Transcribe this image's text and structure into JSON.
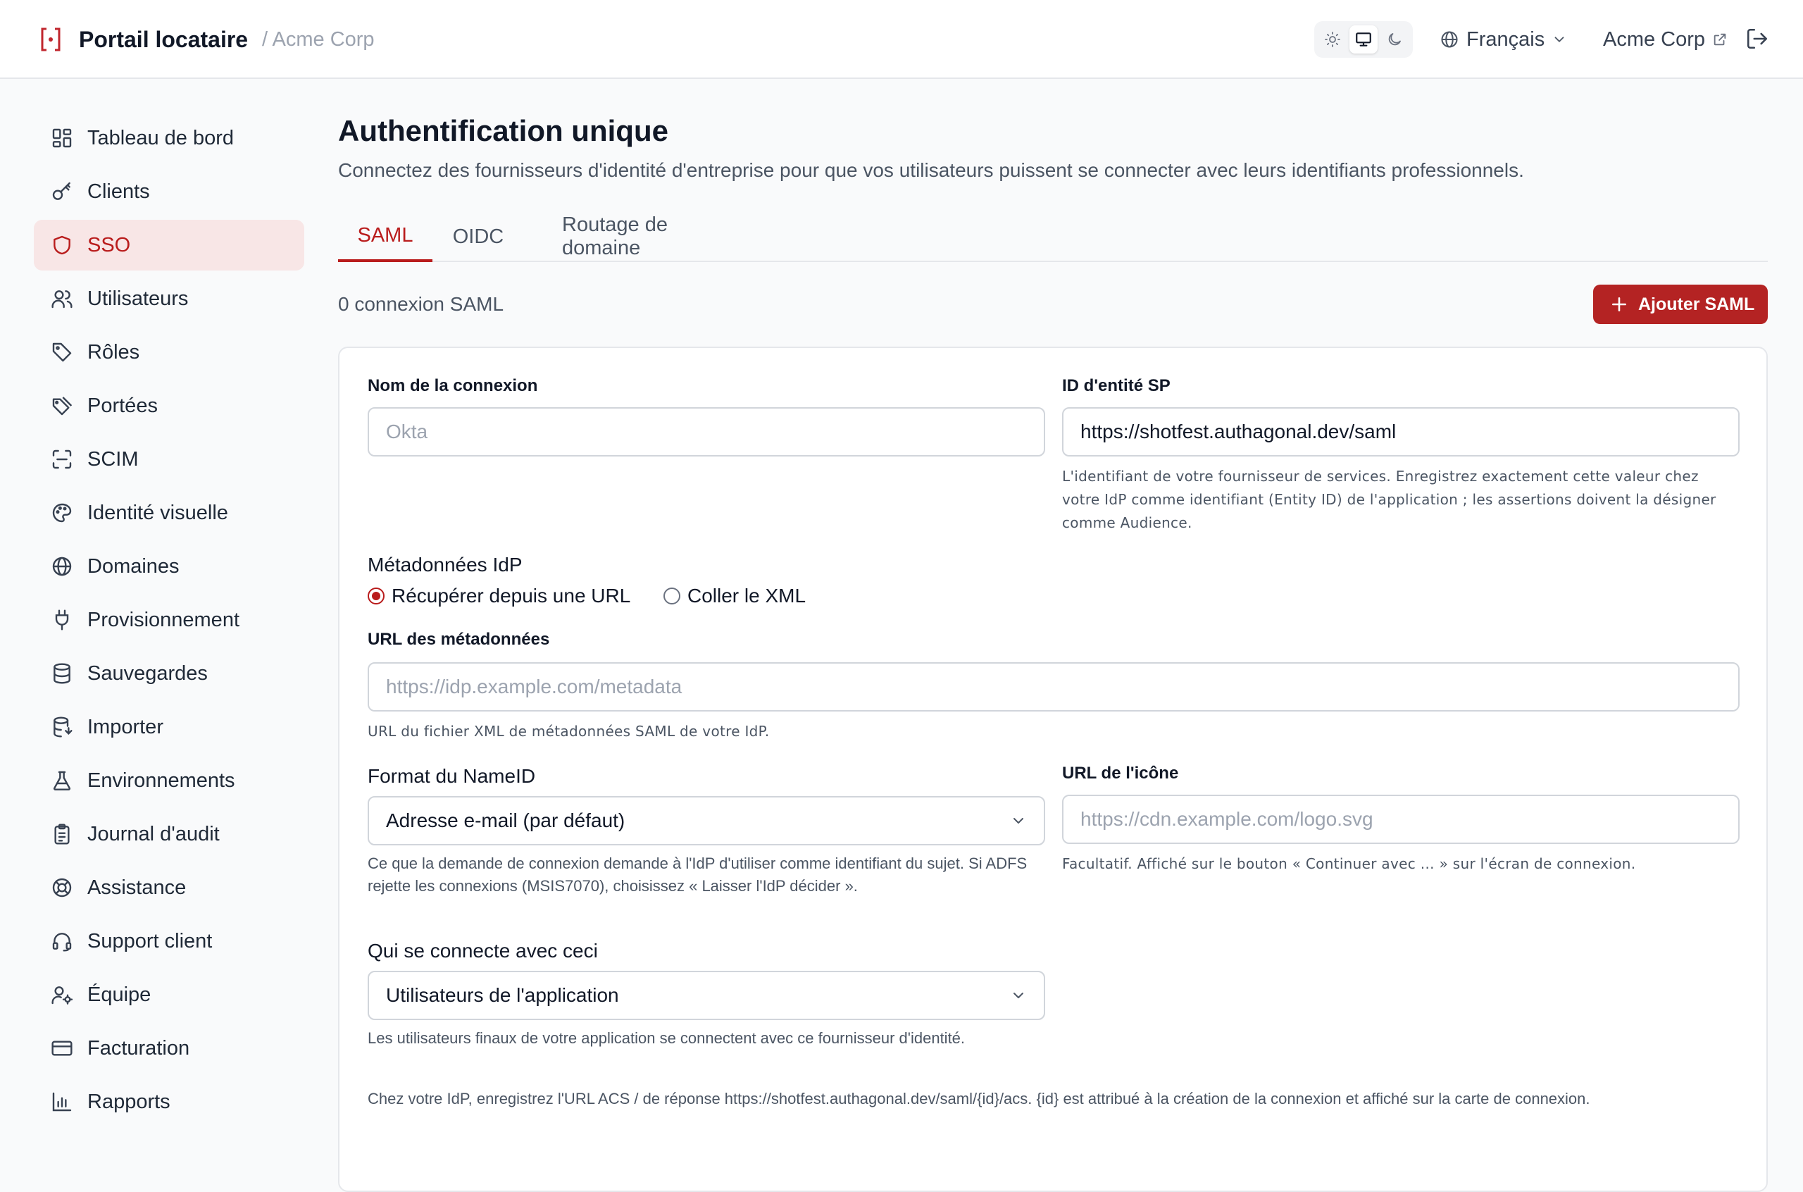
{
  "header": {
    "app_title": "Portail locataire",
    "breadcrumb_sep": "/ Acme Corp",
    "language": "Français",
    "tenant_link": "Acme Corp",
    "theme_options": [
      "light",
      "system",
      "dark"
    ],
    "theme_selected": "system"
  },
  "sidebar": {
    "items": [
      {
        "label": "Tableau de bord",
        "icon": "dashboard-icon"
      },
      {
        "label": "Clients",
        "icon": "key-icon"
      },
      {
        "label": "SSO",
        "icon": "shield-icon",
        "active": true
      },
      {
        "label": "Utilisateurs",
        "icon": "users-icon"
      },
      {
        "label": "Rôles",
        "icon": "tag-icon"
      },
      {
        "label": "Portées",
        "icon": "tags-icon"
      },
      {
        "label": "SCIM",
        "icon": "scan-icon"
      },
      {
        "label": "Identité visuelle",
        "icon": "palette-icon"
      },
      {
        "label": "Domaines",
        "icon": "globe-icon"
      },
      {
        "label": "Provisionnement",
        "icon": "plug-icon"
      },
      {
        "label": "Sauvegardes",
        "icon": "database-icon"
      },
      {
        "label": "Importer",
        "icon": "database-import-icon"
      },
      {
        "label": "Environnements",
        "icon": "flask-icon"
      },
      {
        "label": "Journal d'audit",
        "icon": "clipboard-icon"
      },
      {
        "label": "Assistance",
        "icon": "lifebuoy-icon"
      },
      {
        "label": "Support client",
        "icon": "headset-icon"
      },
      {
        "label": "Équipe",
        "icon": "user-cog-icon"
      },
      {
        "label": "Facturation",
        "icon": "credit-card-icon"
      },
      {
        "label": "Rapports",
        "icon": "bar-chart-icon"
      }
    ]
  },
  "main": {
    "title": "Authentification unique",
    "description": "Connectez des fournisseurs d'identité d'entreprise pour que vos utilisateurs puissent se connecter avec leurs identifiants professionnels.",
    "tabs": [
      {
        "label": "SAML",
        "active": true
      },
      {
        "label": "OIDC"
      },
      {
        "label": "Routage de domaine"
      }
    ],
    "count_label": "0 connexion SAML",
    "add_button": "Ajouter SAML"
  },
  "form": {
    "connection_name": {
      "label": "Nom de la connexion",
      "placeholder": "Okta",
      "value": ""
    },
    "sp_entity_id": {
      "label": "ID d'entité SP",
      "value": "https://shotfest.authagonal.dev/saml",
      "help": "L'identifiant de votre fournisseur de services. Enregistrez exactement cette valeur chez votre IdP comme identifiant (Entity ID) de l'application ; les assertions doivent la désigner comme Audience."
    },
    "idp_metadata": {
      "label": "Métadonnées IdP",
      "options": [
        "Récupérer depuis une URL",
        "Coller le XML"
      ],
      "selected": "Récupérer depuis une URL"
    },
    "metadata_url": {
      "label": "URL des métadonnées",
      "placeholder": "https://idp.example.com/metadata",
      "help": "URL du fichier XML de métadonnées SAML de votre IdP."
    },
    "nameid_format": {
      "label": "Format du NameID",
      "value": "Adresse e-mail (par défaut)",
      "help": "Ce que la demande de connexion demande à l'IdP d'utiliser comme identifiant du sujet. Si ADFS rejette les connexions (MSIS7070), choisissez « Laisser l'IdP décider »."
    },
    "icon_url": {
      "label": "URL de l'icône",
      "placeholder": "https://cdn.example.com/logo.svg",
      "help": "Facultatif. Affiché sur le bouton « Continuer avec … » sur l'écran de connexion."
    },
    "who_connects": {
      "label": "Qui se connecte avec ceci",
      "value": "Utilisateurs de l'application",
      "help": "Les utilisateurs finaux de votre application se connectent avec ce fournisseur d'identité."
    },
    "acs_note": "Chez votre IdP, enregistrez l'URL ACS / de réponse https://shotfest.authagonal.dev/saml/{id}/acs. {id} est attribué à la création de la connexion et affiché sur la carte de connexion."
  },
  "colors": {
    "accent": "#b91c1c",
    "accent_button": "#b42323",
    "active_nav_bg": "#f8e6e6"
  }
}
